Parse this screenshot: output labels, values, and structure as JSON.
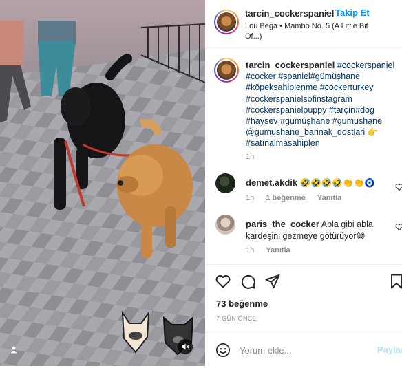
{
  "media": {
    "mute_icon": "speaker-muted-icon",
    "tag_icon": "person-tag-icon"
  },
  "post": {
    "username": "tarcin_cockerspaniel",
    "separator": "•",
    "follow_label": "Takip Et",
    "audio": "Lou Bega • Mambo No. 5 (A Little Bit Of...)",
    "caption_hashtags_1": "#cockerspaniel #cocker #spaniel#gümüşhane #köpeksahiplenme #cockerturkey #cockerspanielsofinstagram #cockerspanielpuppy #tarçın#dog #haysev #gümüşhane #gumushane",
    "caption_mention": "@gumushane_barinak_dostlari",
    "caption_emoji": "👉",
    "caption_hashtags_2": "#satınalmasahiplen",
    "caption_time": "1h"
  },
  "comments": [
    {
      "username": "demet.akdik",
      "text": "🤣🤣🤣🤣👏👏🧿",
      "time": "1h",
      "likes": "1 beğenme",
      "reply": "Yanıtla"
    },
    {
      "username": "paris_the_cocker",
      "text": "Abla gibi abla kardeşini gezmeye götürüyor😄",
      "time": "1h",
      "reply": "Yanıtla"
    }
  ],
  "actions": {
    "like_icon": "heart-icon",
    "comment_icon": "comment-icon",
    "share_icon": "paper-plane-icon",
    "save_icon": "bookmark-icon",
    "likes_count": "73 beğenme",
    "posted_ago": "7 GÜN ÖNCE"
  },
  "add_comment": {
    "emoji_icon": "smiley-icon",
    "placeholder": "Yorum ekle...",
    "post_label": "Paylaş"
  }
}
